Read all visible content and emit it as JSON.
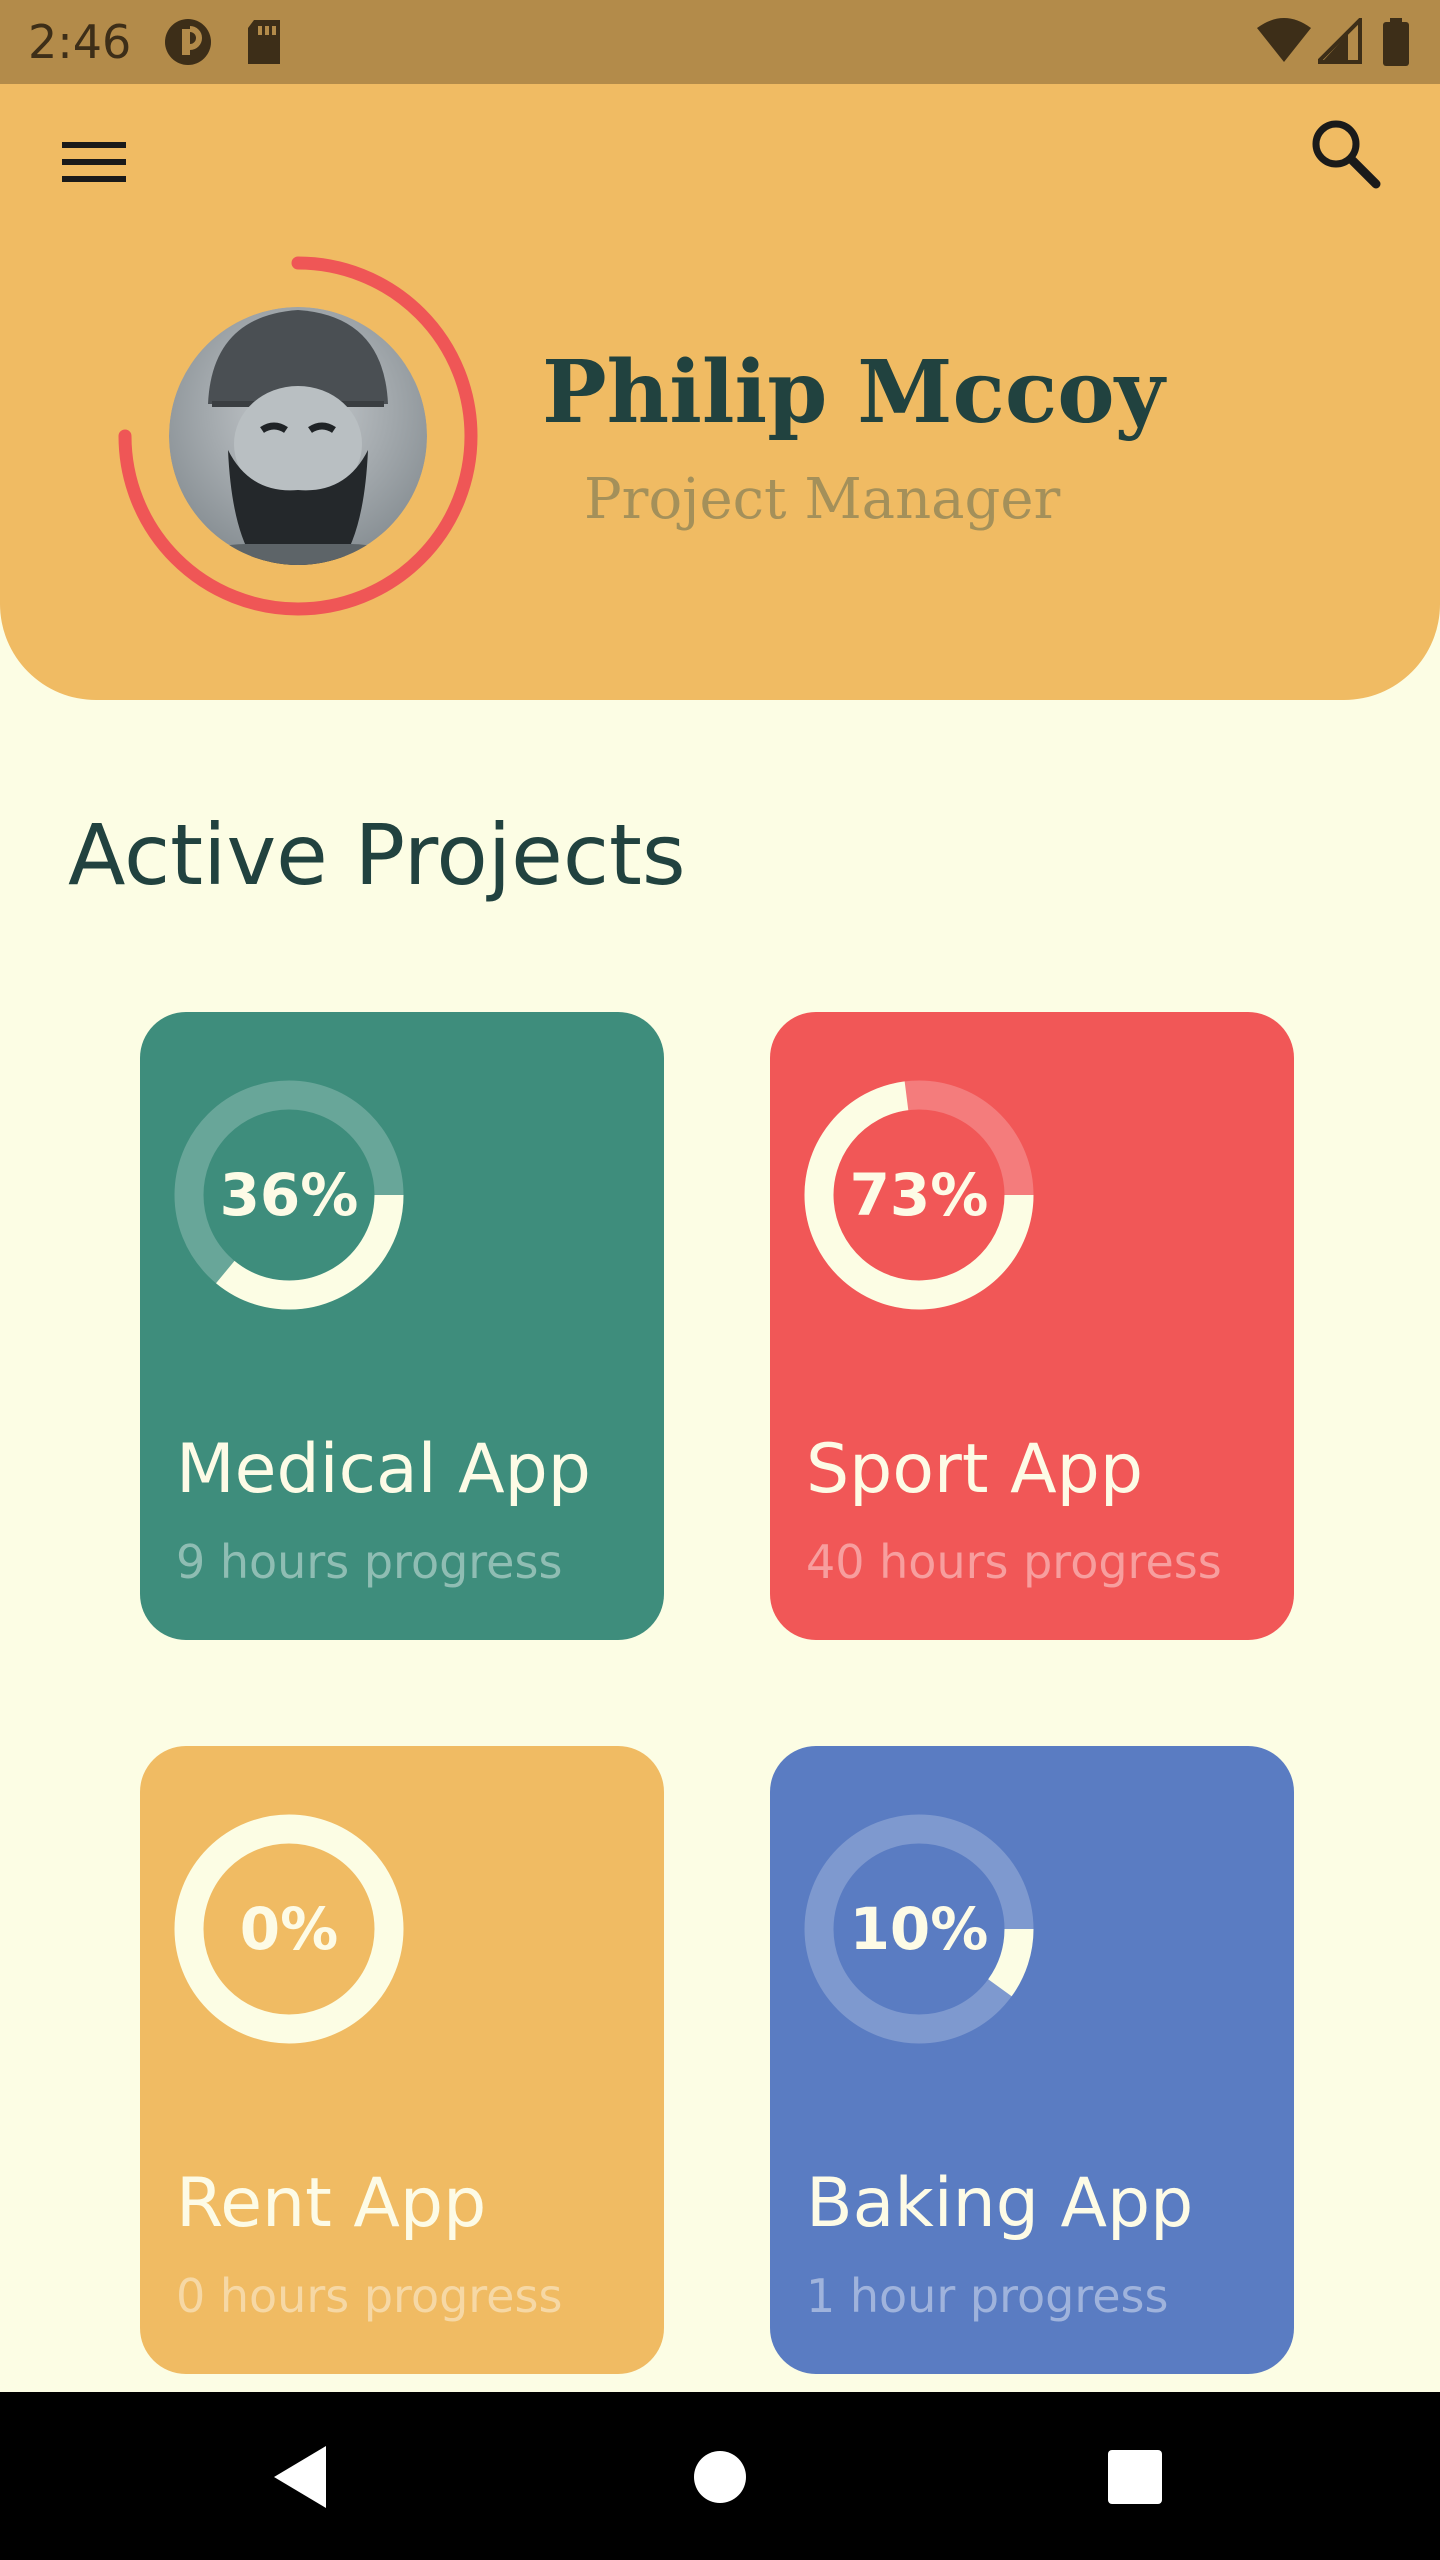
{
  "status_bar": {
    "time": "2:46",
    "left_icons": [
      "sync-icon",
      "sd-card-icon"
    ],
    "right_icons": [
      "wifi-icon",
      "cell-signal-icon",
      "battery-icon"
    ]
  },
  "header": {
    "menu_icon": "menu-icon",
    "search_icon": "search-icon",
    "name": "Philip Mccoy",
    "role": "Project Manager",
    "avatar_ring_color": "#ef5656"
  },
  "section_title": "Active Projects",
  "projects": [
    {
      "percent_label": "36%",
      "progress": 0.36,
      "title": "Medical App",
      "subtitle": "9 hours progress",
      "color": "#3e8d7c"
    },
    {
      "percent_label": "73%",
      "progress": 0.73,
      "title": "Sport App",
      "subtitle": "40 hours progress",
      "color": "#f15757"
    },
    {
      "percent_label": "0%",
      "progress": 0.0,
      "title": "Rent App",
      "subtitle": "0 hours progress",
      "color": "#f0bb63"
    },
    {
      "percent_label": "10%",
      "progress": 0.1,
      "title": "Baking App",
      "subtitle": "1 hour progress",
      "color": "#5a7cc2"
    }
  ],
  "nav_bar": {
    "back_icon": "back-triangle-icon",
    "home_icon": "home-circle-icon",
    "recents_icon": "recents-square-icon"
  }
}
